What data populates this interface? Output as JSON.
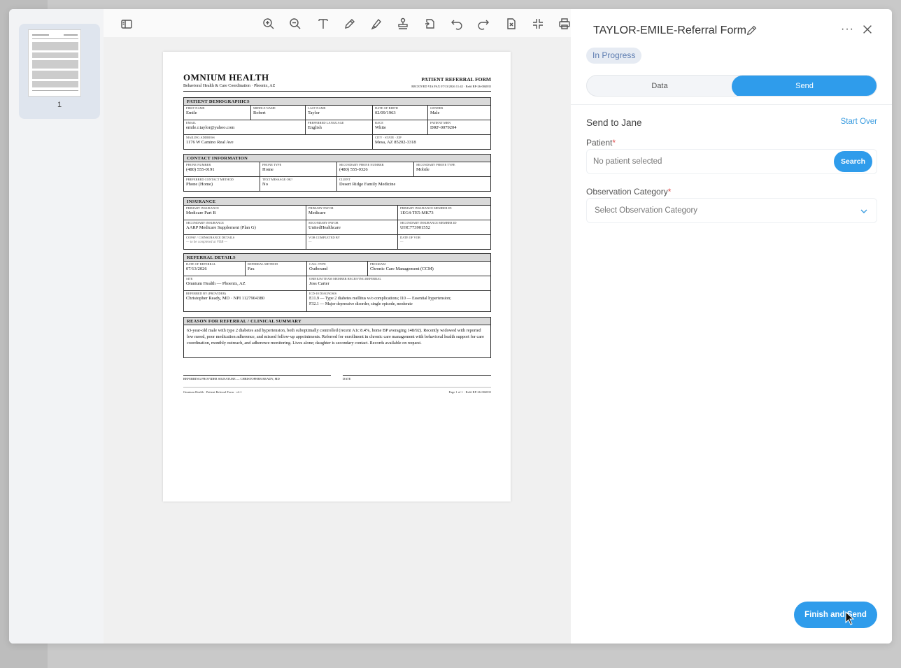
{
  "thumbnail": {
    "page_number": "1"
  },
  "document": {
    "org": "OMNIUM HEALTH",
    "org_sub": "Behavioral Health & Care Coordination · Phoenix, AZ",
    "title": "PATIENT REFERRAL FORM",
    "received": "RECEIVED VIA FAX 07/13/2026 11:42 · Ref# RP-26-004835",
    "demographics": {
      "header": "PATIENT DEMOGRAPHICS",
      "first_name_label": "FIRST NAME",
      "first_name": "Emile",
      "middle_name_label": "MIDDLE NAME",
      "middle_name": "Robert",
      "last_name_label": "LAST NAME",
      "last_name": "Taylor",
      "dob_label": "DATE OF BIRTH",
      "dob": "02/09/1963",
      "gender_label": "GENDER",
      "gender": "Male",
      "email_label": "EMAIL",
      "email": "emile.r.taylor@yahoo.com",
      "language_label": "PREFERRED LANGUAGE",
      "language": "English",
      "race_label": "RACE",
      "race": "White",
      "mrn_label": "PATIENT MRN",
      "mrn": "DRF-0079204",
      "address_label": "MAILING ADDRESS",
      "address": "1176 W Camino Real Ave",
      "city_label": "CITY · STATE · ZIP",
      "city": "Mesa, AZ 85202-3318"
    },
    "contact": {
      "header": "CONTACT INFORMATION",
      "phone_label": "PHONE NUMBER",
      "phone": "(480) 555-0191",
      "phone_type_label": "PHONE TYPE",
      "phone_type": "Home",
      "sec_phone_label": "SECONDARY PHONE NUMBER",
      "sec_phone": "(480) 555-0326",
      "sec_phone_type_label": "SECONDARY PHONE TYPE",
      "sec_phone_type": "Mobile",
      "method_label": "PREFERRED CONTACT METHOD",
      "method": "Phone (Home)",
      "text_ok_label": "TEXT MESSAGE OK?",
      "text_ok": "No",
      "client_label": "CLIENT",
      "client": "Desert Ridge Family Medicine"
    },
    "insurance": {
      "header": "INSURANCE",
      "primary_label": "PRIMARY INSURANCE",
      "primary": "Medicare Part B",
      "primary_payor_label": "PRIMARY PAYOR",
      "primary_payor": "Medicare",
      "primary_id_label": "PRIMARY INSURANCE MEMBER ID",
      "primary_id": "1EG4-TE5-MK73",
      "secondary_label": "SECONDARY INSURANCE",
      "secondary": "AARP Medicare Supplement (Plan G)",
      "secondary_payor_label": "SECONDARY PAYOR",
      "secondary_payor": "UnitedHealthcare",
      "secondary_id_label": "SECONDARY INSURANCE MEMBER ID",
      "secondary_id": "UHC773901552",
      "copay_label": "COPAY / COINSURANCE DETAILS",
      "copay": "— to be completed at VOB —",
      "vob_by_label": "VOB COMPLETED BY",
      "vob_by": "—",
      "vob_date_label": "DATE OF VOB",
      "vob_date": "—"
    },
    "referral": {
      "header": "REFERRAL DETAILS",
      "date_label": "DATE OF REFERRAL",
      "date": "07/13/2026",
      "method_label": "REFERRAL METHOD",
      "method": "Fax",
      "call_type_label": "CALL TYPE",
      "call_type": "Outbound",
      "program_label": "PROGRAM",
      "program": "Chronic Care Management (CCM)",
      "site_label": "SITE",
      "site": "Omnium Health — Phoenix, AZ",
      "team_label": "OMNIUM TEAM MEMBER RECEIVING REFERRAL",
      "team": "Joss Carter",
      "by_label": "REFERRED BY (PROVIDER)",
      "by": "Christopher Ready, MD · NPI 1127904380",
      "icd_label": "ICD-10 DIAGNOSIS",
      "icd_1": "E11.9 — Type 2 diabetes mellitus w/o complications; I10 — Essential hypertension;",
      "icd_2": "F32.1 — Major depressive disorder, single episode, moderate"
    },
    "reason": {
      "header": "REASON FOR REFERRAL / CLINICAL SUMMARY",
      "text": "63-year-old male with type 2 diabetes and hypertension, both suboptimally controlled (recent A1c 8.4%, home BP averaging 148/92). Recently widowed with reported low mood, poor medication adherence, and missed follow-up appointments. Referred for enrollment in chronic care management with behavioral health support for care coordination, monthly outreach, and adherence monitoring. Lives alone; daughter is secondary contact. Records available on request."
    },
    "signature_label": "REFERRING PROVIDER SIGNATURE — CHRISTOPHER READY, MD",
    "date_label": "DATE",
    "footer_left": "Omnium Health · Patient Referral Form · v2.1",
    "footer_right": "Page 1 of 1 · Ref# RP-26-004835"
  },
  "panel": {
    "title": "TAYLOR-EMILE-Referral Form",
    "more": "···",
    "status": "In Progress",
    "tabs": {
      "data": "Data",
      "send": "Send"
    },
    "send_to": "Send to Jane",
    "start_over": "Start Over",
    "patient_label": "Patient",
    "patient_placeholder": "No patient selected",
    "search_button": "Search",
    "category_label": "Observation Category",
    "category_placeholder": "Select Observation Category",
    "required_mark": "*",
    "finish_button": "Finish and Send"
  },
  "colors": {
    "accent": "#2f9ceb",
    "badge_bg": "#e6ebf3",
    "badge_text": "#5b7bb0",
    "required": "#e04848"
  },
  "icons": [
    "sidebar-toggle-icon",
    "zoom-in-icon",
    "zoom-out-icon",
    "text-icon",
    "pen-icon",
    "highlighter-icon",
    "stamp-icon",
    "rotate-page-icon",
    "undo-icon",
    "redo-icon",
    "export-icon",
    "collapse-icon",
    "print-icon",
    "edit-icon",
    "more-icon",
    "close-icon",
    "chevron-down-icon"
  ]
}
